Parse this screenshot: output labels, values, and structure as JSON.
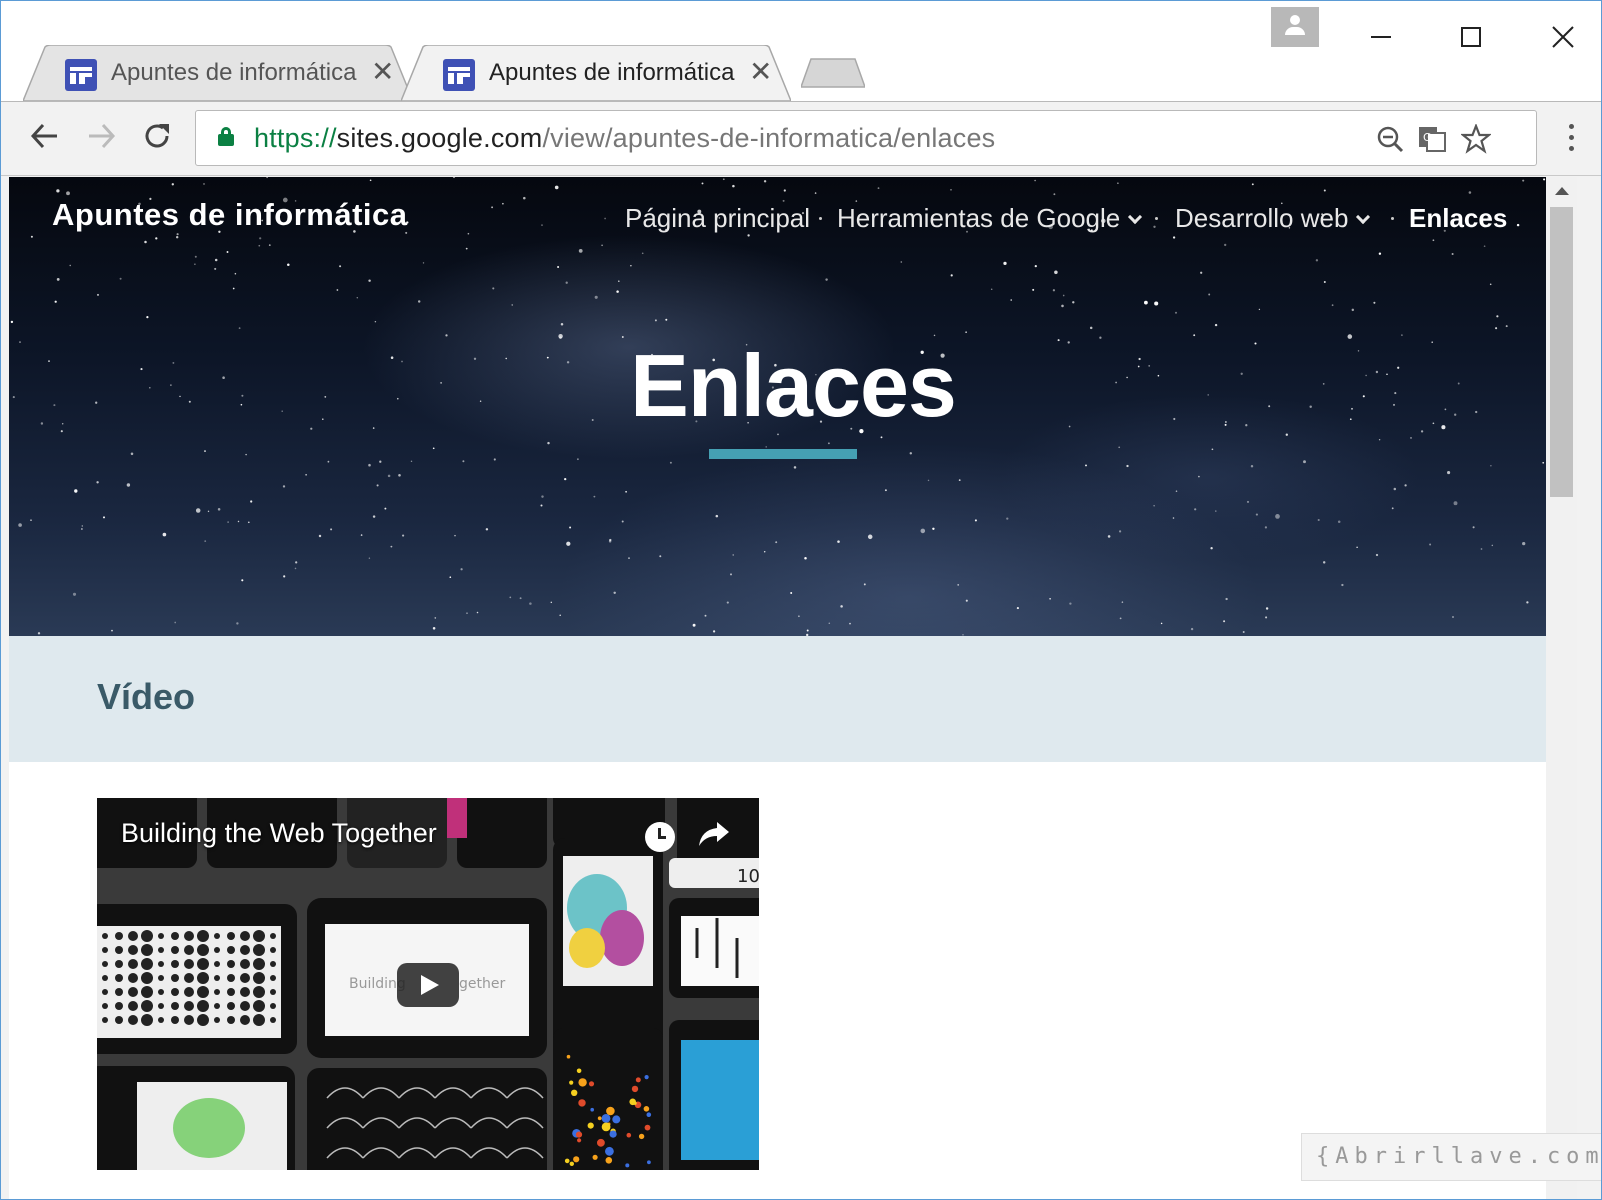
{
  "browser": {
    "tabs": [
      {
        "title": "Apuntes de informática",
        "favicon": "google-sites-icon",
        "active": false
      },
      {
        "title": "Apuntes de informática -",
        "favicon": "google-sites-icon",
        "active": true
      }
    ],
    "url": {
      "scheme": "https://",
      "host": "sites.google.com",
      "path": "/view/apuntes-de-informatica/enlaces"
    },
    "omnibox_icons": [
      "zoom-icon",
      "translate-icon",
      "bookmark-star-icon"
    ]
  },
  "site": {
    "title": "Apuntes de informática",
    "nav": [
      {
        "label": "Página principal",
        "has_dropdown": false,
        "current": false
      },
      {
        "label": "Herramientas de Google",
        "has_dropdown": true,
        "current": false
      },
      {
        "label": "Desarrollo web",
        "has_dropdown": true,
        "current": false
      },
      {
        "label": "Enlaces",
        "has_dropdown": false,
        "current": true
      }
    ],
    "hero_heading": "Enlaces",
    "accent_color": "#45a0b3"
  },
  "section": {
    "title": "Vídeo"
  },
  "video": {
    "title": "Building the Web Together",
    "thumb_text_left": "Building",
    "thumb_text_right": "gether",
    "thumb_badge": "10"
  },
  "watermark": "{Abrirllave.com"
}
